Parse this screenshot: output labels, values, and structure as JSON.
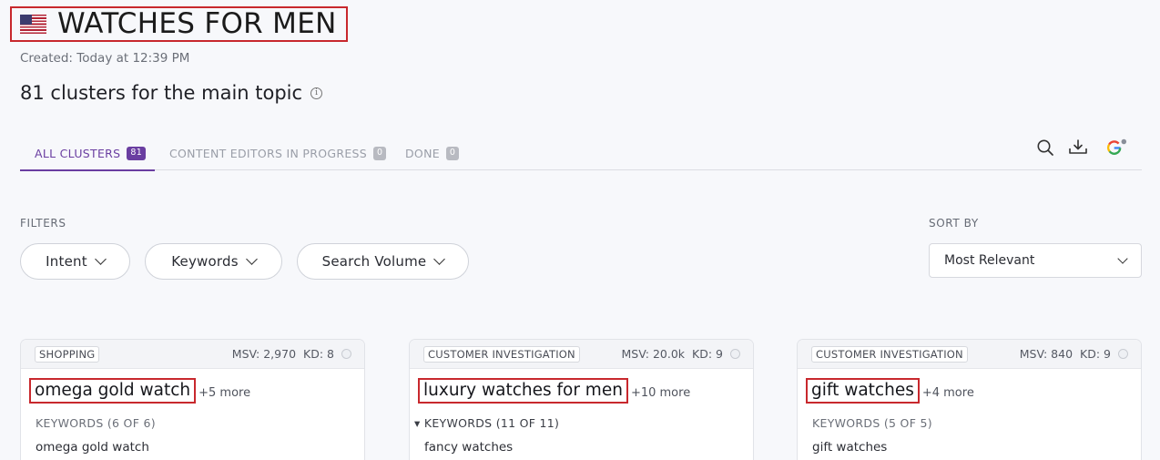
{
  "header": {
    "title": "WATCHES FOR MEN",
    "flag": "us-flag",
    "created": "Created: Today at 12:39 PM",
    "clusters_heading": "81 clusters for the main topic",
    "info_glyph": "i"
  },
  "tabs": [
    {
      "label": "ALL CLUSTERS",
      "count": "81",
      "active": true
    },
    {
      "label": "CONTENT EDITORS IN PROGRESS",
      "count": "0",
      "active": false
    },
    {
      "label": "DONE",
      "count": "0",
      "active": false
    }
  ],
  "toolbar": {
    "icons": [
      "search-icon",
      "download-icon",
      "google-icon"
    ]
  },
  "filters": {
    "label": "FILTERS",
    "buttons": [
      "Intent",
      "Keywords",
      "Search Volume"
    ]
  },
  "sort": {
    "label": "SORT BY",
    "value": "Most Relevant"
  },
  "cards": [
    {
      "intent": "SHOPPING",
      "msv": "MSV: 2,970",
      "kd": "KD: 8",
      "topic": "omega gold watch",
      "more": "+5 more",
      "keywords_label": "KEYWORDS (6 OF 6)",
      "first_keyword": "omega gold watch"
    },
    {
      "intent": "CUSTOMER INVESTIGATION",
      "msv": "MSV: 20.0k",
      "kd": "KD: 9",
      "topic": "luxury watches for men",
      "more": "+10 more",
      "keywords_label": "▾ KEYWORDS (11 OF 11)",
      "first_keyword": "fancy watches"
    },
    {
      "intent": "CUSTOMER INVESTIGATION",
      "msv": "MSV: 840",
      "kd": "KD: 9",
      "topic": "gift watches",
      "more": "+4 more",
      "keywords_label": "KEYWORDS (5 OF 5)",
      "first_keyword": "gift watches"
    }
  ],
  "colors": {
    "accent": "#6a3ea1",
    "highlight_border": "#c8282d"
  }
}
